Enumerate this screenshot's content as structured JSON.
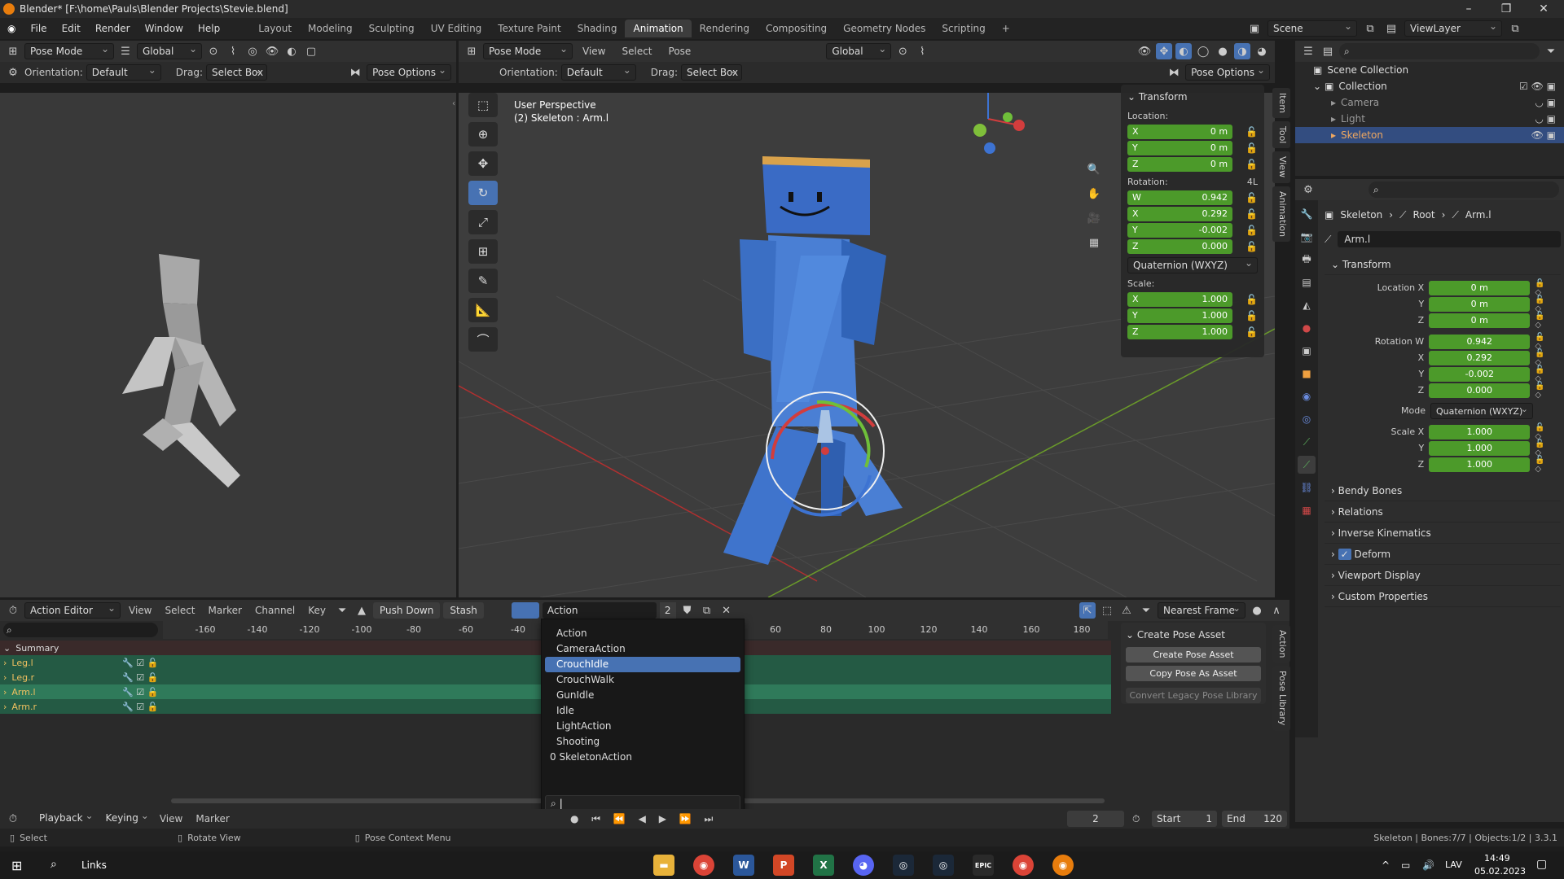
{
  "window": {
    "title": "Blender* [F:\\home\\Pauls\\Blender Projects\\Stevie.blend]"
  },
  "menu": [
    "File",
    "Edit",
    "Render",
    "Window",
    "Help"
  ],
  "workspaces": [
    "Layout",
    "Modeling",
    "Sculpting",
    "UV Editing",
    "Texture Paint",
    "Shading",
    "Animation",
    "Rendering",
    "Compositing",
    "Geometry Nodes",
    "Scripting"
  ],
  "active_workspace": "Animation",
  "scene": {
    "label": "Scene",
    "view_layer": "ViewLayer"
  },
  "left_header": {
    "mode": "Pose Mode",
    "transform": "Global",
    "orientation_label": "Orientation:",
    "orientation": "Default",
    "drag_label": "Drag:",
    "drag": "Select Box",
    "options": "Pose Options"
  },
  "viewport_header": {
    "mode": "Pose Mode",
    "menus": [
      "View",
      "Select",
      "Pose"
    ],
    "transform": "Global",
    "orientation_label": "Orientation:",
    "orientation": "Default",
    "drag_label": "Drag:",
    "drag": "Select Box",
    "options": "Pose Options"
  },
  "viewport": {
    "perspective": "User Perspective",
    "object": "(2) Skeleton : Arm.l"
  },
  "n_panel": {
    "title": "Transform",
    "location_label": "Location:",
    "location": {
      "x": "0 m",
      "y": "0 m",
      "z": "0 m"
    },
    "rotation_label": "Rotation:",
    "rotation_tag": "4L",
    "rotation": {
      "w": "0.942",
      "x": "0.292",
      "y": "-0.002",
      "z": "0.000"
    },
    "rotation_mode": "Quaternion (WXYZ)",
    "scale_label": "Scale:",
    "scale": {
      "x": "1.000",
      "y": "1.000",
      "z": "1.000"
    },
    "tabs": [
      "Item",
      "Tool",
      "View",
      "Animation"
    ]
  },
  "outliner": {
    "root": "Scene Collection",
    "collection": "Collection",
    "items": [
      "Camera",
      "Light",
      "Skeleton"
    ]
  },
  "properties": {
    "breadcrumb": [
      "Skeleton",
      "Root",
      "Arm.l"
    ],
    "bone_name": "Arm.l",
    "transform_title": "Transform",
    "location_label": "Location X",
    "location": [
      "0 m",
      "0 m",
      "0 m"
    ],
    "rotation_label": "Rotation W",
    "rotation": [
      "0.942",
      "0.292",
      "-0.002",
      "0.000"
    ],
    "mode_label": "Mode",
    "mode": "Quaternion (WXYZ)",
    "scale_label": "Scale X",
    "scale": [
      "1.000",
      "1.000",
      "1.000"
    ],
    "axis": [
      "X",
      "Y",
      "Z"
    ],
    "sections": [
      "Bendy Bones",
      "Relations",
      "Inverse Kinematics",
      "Deform",
      "Viewport Display",
      "Custom Properties"
    ]
  },
  "action_editor": {
    "editor": "Action Editor",
    "menus": [
      "View",
      "Select",
      "Marker",
      "Channel",
      "Key"
    ],
    "push_down": "Push Down",
    "stash": "Stash",
    "action_name": "Action",
    "user_count": "2",
    "snap": "Nearest Frame",
    "summary": "Summary",
    "channels": [
      "Leg.l",
      "Leg.r",
      "Arm.l",
      "Arm.r"
    ],
    "ticks": [
      "-160",
      "-140",
      "-120",
      "-100",
      "-80",
      "-60",
      "-40",
      "60",
      "80",
      "100",
      "120",
      "140",
      "160",
      "180"
    ]
  },
  "dropdown": {
    "items": [
      "Action",
      "CameraAction",
      "CrouchIdle",
      "CrouchWalk",
      "GunIdle",
      "Idle",
      "LightAction",
      "Shooting",
      "0 SkeletonAction"
    ],
    "selected": "CrouchIdle"
  },
  "pose_panel": {
    "title": "Create Pose Asset",
    "create": "Create Pose Asset",
    "copy": "Copy Pose As Asset",
    "convert": "Convert Legacy Pose Library",
    "tabs": [
      "Action",
      "Pose Library"
    ]
  },
  "timeline": {
    "menus": [
      "Playback",
      "Keying",
      "View",
      "Marker"
    ],
    "current_frame": "2",
    "start_label": "Start",
    "start": "1",
    "end_label": "End",
    "end": "120"
  },
  "status": {
    "select": "Select",
    "rotate": "Rotate View",
    "context": "Pose Context Menu",
    "info": "Skeleton | Bones:7/7 | Objects:1/2 | 3.3.1"
  },
  "taskbar": {
    "search": "Links",
    "lang": "LAV",
    "time": "14:49",
    "date": "05.02.2023",
    "epic": "EPIC"
  },
  "colors": {
    "accent": "#4772b3",
    "field_green": "#4c9a2a",
    "character": "#4a7fd4"
  }
}
